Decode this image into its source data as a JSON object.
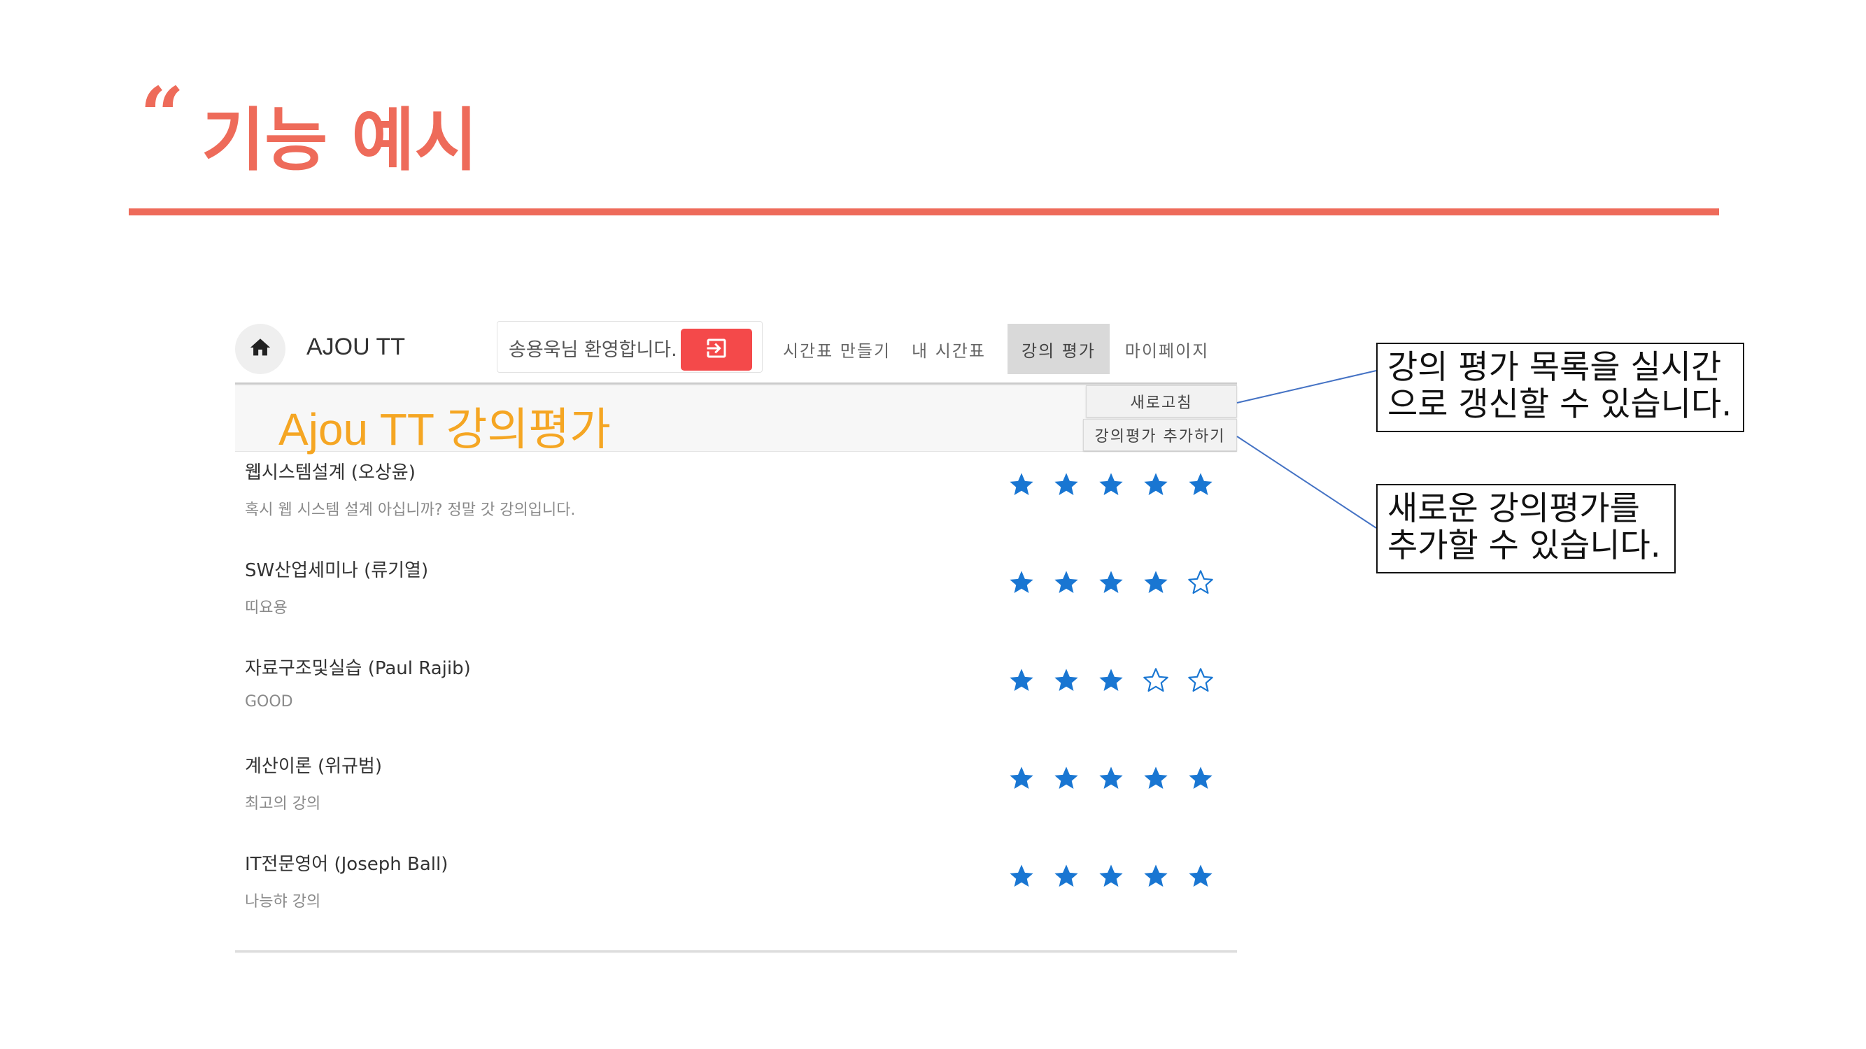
{
  "slide": {
    "quote_mark": "“",
    "title": "기능 예시"
  },
  "navbar": {
    "home_icon": "home-icon",
    "brand": "AJOU TT",
    "welcome_text": "송용욱님 환영합니다.",
    "logout_icon": "logout-icon",
    "items": [
      {
        "label": "시간표 만들기",
        "active": false
      },
      {
        "label": "내 시간표",
        "active": false
      },
      {
        "label": "강의 평가",
        "active": true
      },
      {
        "label": "마이페이지",
        "active": false
      }
    ]
  },
  "page": {
    "title": "Ajou TT 강의평가",
    "refresh_label": "새로고침",
    "add_review_label": "강의평가 추가하기"
  },
  "reviews": [
    {
      "course": "웹시스템설계 (오상윤)",
      "comment": "혹시 웹 시스템 설계 아십니까? 정말 갓 강의입니다.",
      "rating": 5
    },
    {
      "course": "SW산업세미나 (류기열)",
      "comment": "띠요용",
      "rating": 4
    },
    {
      "course": "자료구조및실습 (Paul Rajib)",
      "comment": "GOOD",
      "rating": 3
    },
    {
      "course": "계산이론 (위규범)",
      "comment": "최고의 강의",
      "rating": 5
    },
    {
      "course": "IT전문영어 (Joseph Ball)",
      "comment": "나능햐 강의",
      "rating": 5
    }
  ],
  "rating_max": 5,
  "colors": {
    "accent": "#ee6b5a",
    "app_title": "#f5a623",
    "star": "#1976d2",
    "logout": "#f4494a"
  },
  "callouts": {
    "refresh": "강의 평가 목록을 실시간\n으로 갱신할 수 있습니다.",
    "add": "새로운 강의평가를\n추가할 수 있습니다."
  }
}
